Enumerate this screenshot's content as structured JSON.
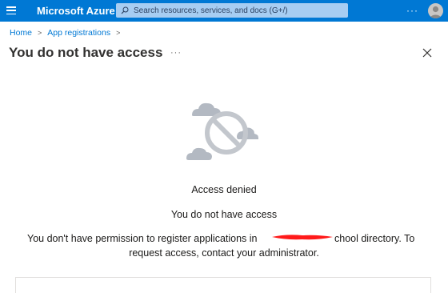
{
  "topbar": {
    "brand": "Microsoft Azure",
    "search_placeholder": "Search resources, services, and docs (G+/)",
    "more_label": "···",
    "color": "#0078d4"
  },
  "breadcrumb": {
    "items": [
      "Home",
      "App registrations"
    ],
    "separator": ">"
  },
  "page": {
    "title": "You do not have access",
    "more_label": "···"
  },
  "message": {
    "heading": "Access denied",
    "subheading": "You do not have access",
    "body_part1": "You don't have permission to register applications in",
    "body_part2": "chool directory. To",
    "body_line2": "request access, contact your administrator."
  },
  "icons": {
    "menu": "hamburger-menu-icon",
    "search": "search-icon",
    "more": "more-icon",
    "avatar": "user-avatar-icon",
    "close": "close-icon",
    "illustration": "access-denied-cloud-icon"
  },
  "colors": {
    "accent": "#0078d4",
    "redaction": "#ff1a1a"
  }
}
